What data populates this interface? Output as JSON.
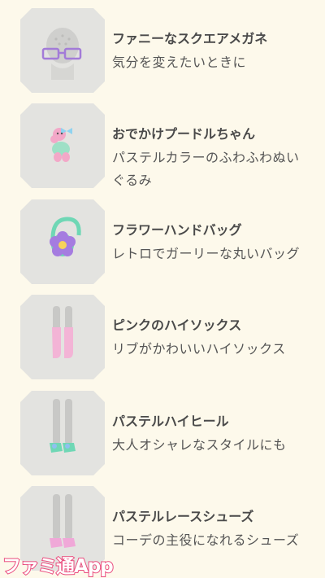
{
  "items": [
    {
      "title": "ファニーなスクエアメガネ",
      "desc": "気分を変えたいときに",
      "icon": "square-glasses-icon"
    },
    {
      "title": "おでかけプードルちゃん",
      "desc": "パステルカラーのふわふわぬいぐるみ",
      "icon": "poodle-plush-icon"
    },
    {
      "title": "フラワーハンドバッグ",
      "desc": "レトロでガーリーな丸いバッグ",
      "icon": "flower-handbag-icon"
    },
    {
      "title": "ピンクのハイソックス",
      "desc": "リブがかわいいハイソックス",
      "icon": "pink-socks-icon"
    },
    {
      "title": "パステルハイヒール",
      "desc": "大人オシャレなスタイルにも",
      "icon": "pastel-heels-icon"
    },
    {
      "title": "パステルレースシューズ",
      "desc": "コーデの主役になれるシューズ",
      "icon": "lace-shoes-icon"
    }
  ],
  "watermark": "ファミ通App",
  "colors": {
    "background": "#fdf9eb",
    "thumb": "#e3e3e0",
    "watermark_fill": "#ffffff",
    "watermark_stroke": "#ea4d7e"
  }
}
